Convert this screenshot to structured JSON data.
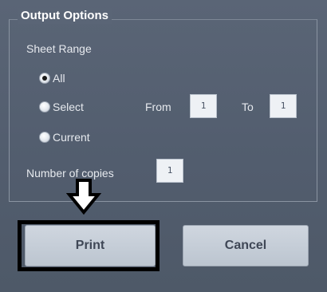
{
  "group": {
    "title": "Output Options"
  },
  "sheet_range": {
    "label": "Sheet Range",
    "options": [
      {
        "label": "All",
        "checked": true
      },
      {
        "label": "Select",
        "checked": false
      },
      {
        "label": "Current",
        "checked": false
      }
    ],
    "from_label": "From",
    "from_value": "1",
    "to_label": "To",
    "to_value": "1"
  },
  "copies": {
    "label": "Number of copies",
    "value": "1"
  },
  "buttons": {
    "print": "Print",
    "cancel": "Cancel"
  },
  "annotation": {
    "arrow_icon": "down-arrow-icon",
    "highlight_color": "#000000"
  }
}
